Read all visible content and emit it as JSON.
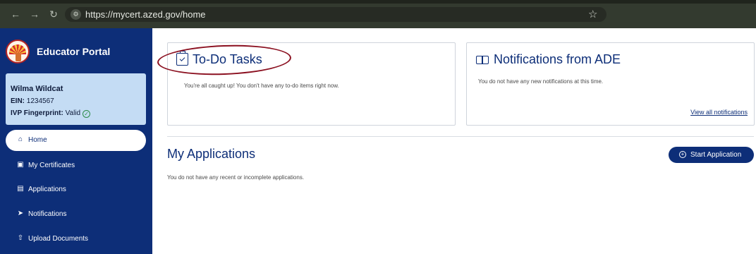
{
  "browser": {
    "url": "https://mycert.azed.gov/home",
    "back_icon": "back-arrow-icon",
    "forward_icon": "forward-arrow-icon",
    "refresh_icon": "refresh-icon",
    "site_icon": "site-settings-icon",
    "bookmark_icon": "star-icon"
  },
  "sidebar": {
    "title": "Educator Portal",
    "user": {
      "name": "Wilma Wildcat",
      "ein_label": "EIN:",
      "ein_value": "1234567",
      "fingerprint_label": "IVP Fingerprint:",
      "fingerprint_value": "Valid"
    },
    "items": [
      {
        "label": "Home",
        "icon": "home-icon"
      },
      {
        "label": "My Certificates",
        "icon": "certificate-icon"
      },
      {
        "label": "Applications",
        "icon": "document-icon"
      },
      {
        "label": "Notifications",
        "icon": "send-icon"
      },
      {
        "label": "Upload Documents",
        "icon": "upload-document-icon"
      }
    ]
  },
  "main": {
    "todo": {
      "title": "To-Do Tasks",
      "message": "You're all caught up! You don't have any to-do items right now."
    },
    "notifications": {
      "title": "Notifications from ADE",
      "message": "You do not have any new notifications at this time.",
      "link": "View all notifications"
    },
    "applications": {
      "title": "My Applications",
      "button": "Start Application",
      "empty": "You do not have any recent or incomplete applications."
    }
  },
  "colors": {
    "sidebar": "#0d2e78",
    "accent": "#0d2e78",
    "highlight": "#8b1020",
    "user_card": "#c4dcf4"
  }
}
